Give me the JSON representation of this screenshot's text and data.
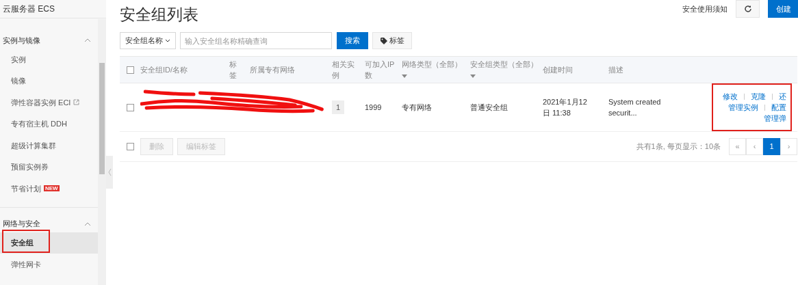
{
  "sidebar": {
    "title": "云服务器 ECS",
    "groups": [
      {
        "label": "实例与镜像",
        "expanded": true,
        "items": [
          {
            "label": "实例",
            "selected": false,
            "highlighted": false
          },
          {
            "label": "镜像",
            "selected": false,
            "highlighted": false
          },
          {
            "label": "弹性容器实例 ECI",
            "selected": false,
            "highlighted": false,
            "external": true
          },
          {
            "label": "专有宿主机 DDH",
            "selected": false,
            "highlighted": false
          },
          {
            "label": "超级计算集群",
            "selected": false,
            "highlighted": false
          },
          {
            "label": "预留实例券",
            "selected": false,
            "highlighted": false
          },
          {
            "label": "节省计划",
            "selected": false,
            "highlighted": false,
            "badge": "NEW"
          }
        ]
      },
      {
        "label": "网络与安全",
        "expanded": true,
        "items": [
          {
            "label": "安全组",
            "selected": true,
            "highlighted": true
          },
          {
            "label": "弹性网卡",
            "selected": false,
            "highlighted": false
          }
        ]
      }
    ]
  },
  "header": {
    "title": "安全组列表",
    "notice_link": "安全使用须知",
    "create_button": "创建"
  },
  "toolbar": {
    "filter_select": "安全组名称",
    "search_placeholder": "输入安全组名称精确查询",
    "search_button": "搜索",
    "tag_button": "标签"
  },
  "table": {
    "columns": [
      {
        "label": "安全组ID/名称",
        "filter": false
      },
      {
        "label": "标签",
        "filter": false
      },
      {
        "label": "所属专有网络",
        "filter": false
      },
      {
        "label": "相关实例",
        "filter": false
      },
      {
        "label": "可加入IP数",
        "filter": false
      },
      {
        "label": "网络类型（全部）",
        "filter": true
      },
      {
        "label": "安全组类型（全部）",
        "filter": true
      },
      {
        "label": "创建时间",
        "filter": false
      },
      {
        "label": "描述",
        "filter": false
      }
    ],
    "header_checked": false,
    "rows": [
      {
        "checked": false,
        "redacted": true,
        "instances": "1",
        "ip_count": "1999",
        "network_type": "专有网络",
        "group_type": "普通安全组",
        "created": "2021年1月12日 11:38",
        "description": "System created securit...",
        "actions_highlighted": true,
        "actions": [
          [
            "修改",
            "克隆",
            "还"
          ],
          [
            "管理实例",
            "配置"
          ],
          [
            "管理弹"
          ]
        ]
      }
    ]
  },
  "footer": {
    "checked": false,
    "buttons": [
      {
        "label": "删除",
        "disabled": true
      },
      {
        "label": "编辑标签",
        "disabled": true
      }
    ],
    "summary": "共有1条, 每页显示：10条",
    "pages": [
      {
        "label": "«",
        "selected": false
      },
      {
        "label": "‹",
        "selected": false
      },
      {
        "label": "1",
        "selected": true
      },
      {
        "label": "›",
        "selected": false
      }
    ]
  }
}
